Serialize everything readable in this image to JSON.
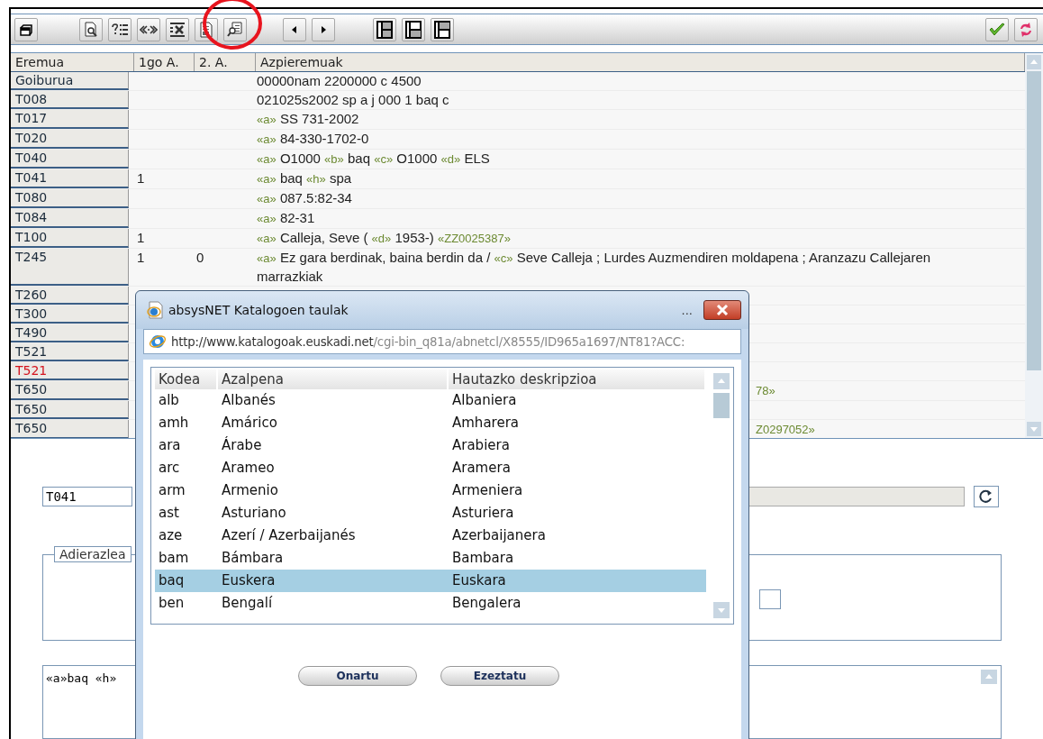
{
  "record_table": {
    "columns": [
      "Eremua",
      "1go A.",
      "2. A.",
      "Azpieremuak"
    ],
    "rows": [
      {
        "field": "Goiburua",
        "flagged": false,
        "parts": [
          {
            "kind": "text",
            "text": "00000nam 2200000 c 4500"
          }
        ]
      },
      {
        "field": "T008",
        "flagged": false,
        "parts": [
          {
            "kind": "text",
            "text": "021025s2002 sp a j 000 1 baq c"
          }
        ]
      },
      {
        "field": "T017",
        "flagged": false,
        "parts": [
          {
            "kind": "code",
            "text": "«a»"
          },
          {
            "kind": "text",
            "text": "SS 731-2002"
          }
        ]
      },
      {
        "field": "T020",
        "flagged": false,
        "parts": [
          {
            "kind": "code",
            "text": "«a»"
          },
          {
            "kind": "text",
            "text": "84-330-1702-0"
          }
        ]
      },
      {
        "field": "T040",
        "flagged": false,
        "parts": [
          {
            "kind": "code",
            "text": "«a»"
          },
          {
            "kind": "text",
            "text": "O1000"
          },
          {
            "kind": "code",
            "text": "«b»"
          },
          {
            "kind": "text",
            "text": "baq"
          },
          {
            "kind": "code",
            "text": "«c»"
          },
          {
            "kind": "text",
            "text": "O1000"
          },
          {
            "kind": "code",
            "text": "«d»"
          },
          {
            "kind": "text",
            "text": "ELS"
          }
        ]
      },
      {
        "field": "T041",
        "flagged": false,
        "ind1": "1",
        "parts": [
          {
            "kind": "code",
            "text": "«a»"
          },
          {
            "kind": "text",
            "text": "baq"
          },
          {
            "kind": "code",
            "text": "«h»"
          },
          {
            "kind": "text",
            "text": "spa"
          }
        ]
      },
      {
        "field": "T080",
        "flagged": false,
        "parts": [
          {
            "kind": "code",
            "text": "«a»"
          },
          {
            "kind": "text",
            "text": "087.5:82-34"
          }
        ]
      },
      {
        "field": "T084",
        "flagged": false,
        "parts": [
          {
            "kind": "code",
            "text": "«a»"
          },
          {
            "kind": "text",
            "text": "82-31"
          }
        ]
      },
      {
        "field": "T100",
        "flagged": false,
        "ind1": "1",
        "parts": [
          {
            "kind": "code",
            "text": "«a»"
          },
          {
            "kind": "text",
            "text": "Calleja, Seve ("
          },
          {
            "kind": "code",
            "text": "«d»"
          },
          {
            "kind": "text",
            "text": "1953-)"
          },
          {
            "kind": "code",
            "text": "«ZZ0025387»"
          }
        ]
      },
      {
        "field": "T245",
        "flagged": false,
        "ind1": "1",
        "ind2": "0",
        "parts": [
          {
            "kind": "code",
            "text": "«a»"
          },
          {
            "kind": "text",
            "text": "Ez gara berdinak, baina berdin da /"
          },
          {
            "kind": "code",
            "text": "«c»"
          },
          {
            "kind": "text",
            "text": "Seve Calleja ; Lurdes Auzmendiren moldapena ; Aranzazu Callejaren marrazkiak"
          }
        ]
      },
      {
        "field": "T260",
        "flagged": false
      },
      {
        "field": "T300",
        "flagged": false
      },
      {
        "field": "T490",
        "flagged": false
      },
      {
        "field": "T521",
        "flagged": false
      },
      {
        "field": "T521",
        "flagged": true
      },
      {
        "field": "T650",
        "flagged": false,
        "peek": "78»"
      },
      {
        "field": "T650",
        "flagged": false
      },
      {
        "field": "T650",
        "flagged": false,
        "peek": "Z0297052»"
      }
    ]
  },
  "editor": {
    "field_value": "T041",
    "indicator_legend": "Adierazlea",
    "subfields_value": "«a»baq «h»"
  },
  "dialog": {
    "title": "absysNET Katalogoen taulak",
    "more": "...",
    "url_host": "http://www.katalogoak.euskadi.net",
    "url_path": "/cgi-bin_q81a/abnetcl/X8555/ID965a1697/NT81?ACC:",
    "columns": [
      "Kodea",
      "Azalpena",
      "Hautazko deskripzioa"
    ],
    "rows": [
      {
        "code": "alb",
        "name": "Albanés",
        "alt": "Albaniera",
        "selected": false
      },
      {
        "code": "amh",
        "name": "Amárico",
        "alt": "Amharera",
        "selected": false
      },
      {
        "code": "ara",
        "name": "Árabe",
        "alt": "Arabiera",
        "selected": false
      },
      {
        "code": "arc",
        "name": "Arameo",
        "alt": "Aramera",
        "selected": false
      },
      {
        "code": "arm",
        "name": "Armenio",
        "alt": "Armeniera",
        "selected": false
      },
      {
        "code": "ast",
        "name": "Asturiano",
        "alt": "Asturiera",
        "selected": false
      },
      {
        "code": "aze",
        "name": "Azerí / Azerbaijanés",
        "alt": "Azerbaijanera",
        "selected": false
      },
      {
        "code": "bam",
        "name": "Bámbara",
        "alt": "Bambara",
        "selected": false
      },
      {
        "code": "baq",
        "name": "Euskera",
        "alt": "Euskara",
        "selected": true
      },
      {
        "code": "ben",
        "name": "Bengalí",
        "alt": "Bengalera",
        "selected": false
      }
    ],
    "buttons": [
      "Onartu",
      "Ezeztatu"
    ]
  }
}
